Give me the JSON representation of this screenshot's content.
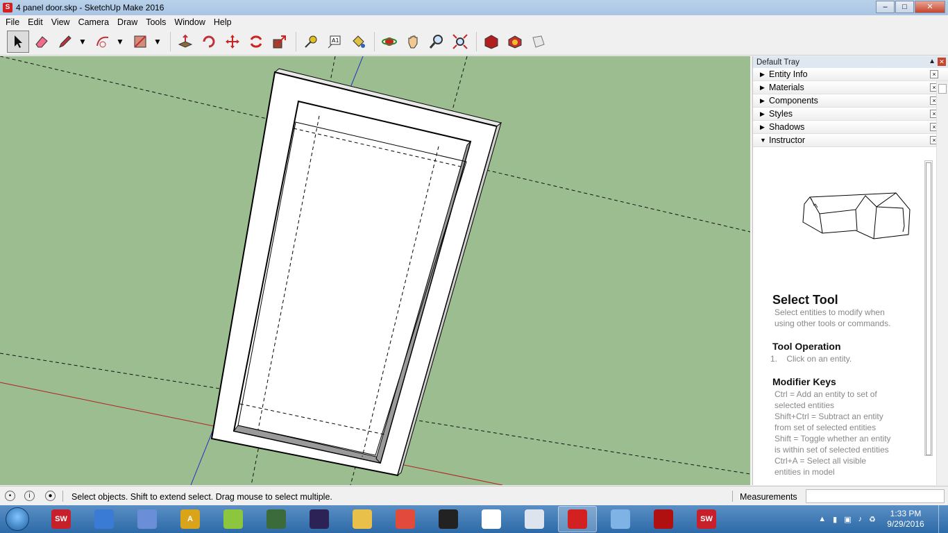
{
  "window": {
    "title": "4 panel door.skp - SketchUp Make 2016",
    "app_icon": "sketchup-icon",
    "controls": [
      "minimize-icon",
      "maximize-icon",
      "close-icon"
    ]
  },
  "menu": {
    "items": [
      "File",
      "Edit",
      "View",
      "Camera",
      "Draw",
      "Tools",
      "Window",
      "Help"
    ]
  },
  "toolbar": {
    "tools": [
      "select-icon",
      "eraser-icon",
      "pencil-icon",
      "arc-icon",
      "rectangle-icon",
      "push-pull-icon",
      "follow-me-icon",
      "move-icon",
      "rotate-icon",
      "scale-icon",
      "tape-measure-icon",
      "text-icon",
      "paint-bucket-icon",
      "orbit-icon",
      "pan-icon",
      "zoom-icon",
      "zoom-extents-icon",
      "warehouse-icon",
      "extension-warehouse-icon",
      "layout-icon"
    ]
  },
  "tray": {
    "title": "Default Tray",
    "panels": [
      {
        "label": "Entity Info",
        "expanded": false
      },
      {
        "label": "Materials",
        "expanded": false
      },
      {
        "label": "Components",
        "expanded": false
      },
      {
        "label": "Styles",
        "expanded": false
      },
      {
        "label": "Shadows",
        "expanded": false
      },
      {
        "label": "Instructor",
        "expanded": true
      }
    ],
    "instructor": {
      "title": "Select Tool",
      "description": [
        "Select entities to modify when",
        "using other tools or commands."
      ],
      "operation_heading": "Tool Operation",
      "operation_step": "1.    Click on an entity.",
      "modifier_heading": "Modifier Keys",
      "modifiers": [
        "Ctrl = Add an entity to set of",
        "selected entities",
        "Shift+Ctrl = Subtract an entity",
        "from set of selected entities",
        "Shift = Toggle whether an entity",
        "is within set of selected entities",
        "Ctrl+A = Select all visible",
        "entities in model"
      ]
    }
  },
  "status": {
    "message": "Select objects. Shift to extend select. Drag mouse to select multiple.",
    "measurements_label": "Measurements",
    "measurements_value": ""
  },
  "taskbar": {
    "apps": [
      {
        "name": "solidworks",
        "label": "SW",
        "color": "#c8202a",
        "active": false
      },
      {
        "name": "thunderbird",
        "label": "",
        "color": "#3a7bd5",
        "active": false
      },
      {
        "name": "paint-net",
        "label": "",
        "color": "#6a8fd8",
        "active": false
      },
      {
        "name": "autodesk",
        "label": "A",
        "color": "#d9a41a",
        "active": false
      },
      {
        "name": "android",
        "label": "",
        "color": "#8cc63f",
        "active": false
      },
      {
        "name": "game",
        "label": "",
        "color": "#3b6b3b",
        "active": false
      },
      {
        "name": "eclipse",
        "label": "",
        "color": "#2c2255",
        "active": false
      },
      {
        "name": "explorer",
        "label": "",
        "color": "#e8c04a",
        "active": false
      },
      {
        "name": "chrome",
        "label": "",
        "color": "#e24a3b",
        "active": false
      },
      {
        "name": "inkscape",
        "label": "",
        "color": "#222222",
        "active": false
      },
      {
        "name": "app-grid",
        "label": "",
        "color": "#ffffff",
        "active": false
      },
      {
        "name": "notepad",
        "label": "",
        "color": "#dde4ee",
        "active": false
      },
      {
        "name": "sketchup",
        "label": "",
        "color": "#d32020",
        "active": true
      },
      {
        "name": "paint",
        "label": "",
        "color": "#7fb3e6",
        "active": false
      },
      {
        "name": "acrobat",
        "label": "",
        "color": "#b01010",
        "active": false
      },
      {
        "name": "solidworks-2",
        "label": "SW",
        "color": "#c8202a",
        "active": false
      }
    ],
    "clock_time": "1:33 PM",
    "clock_date": "9/29/2016"
  },
  "colors": {
    "viewport_bg": "#9bbd8f",
    "title_bar": "#b9d1ea",
    "taskbar": "#2d6aa8"
  }
}
